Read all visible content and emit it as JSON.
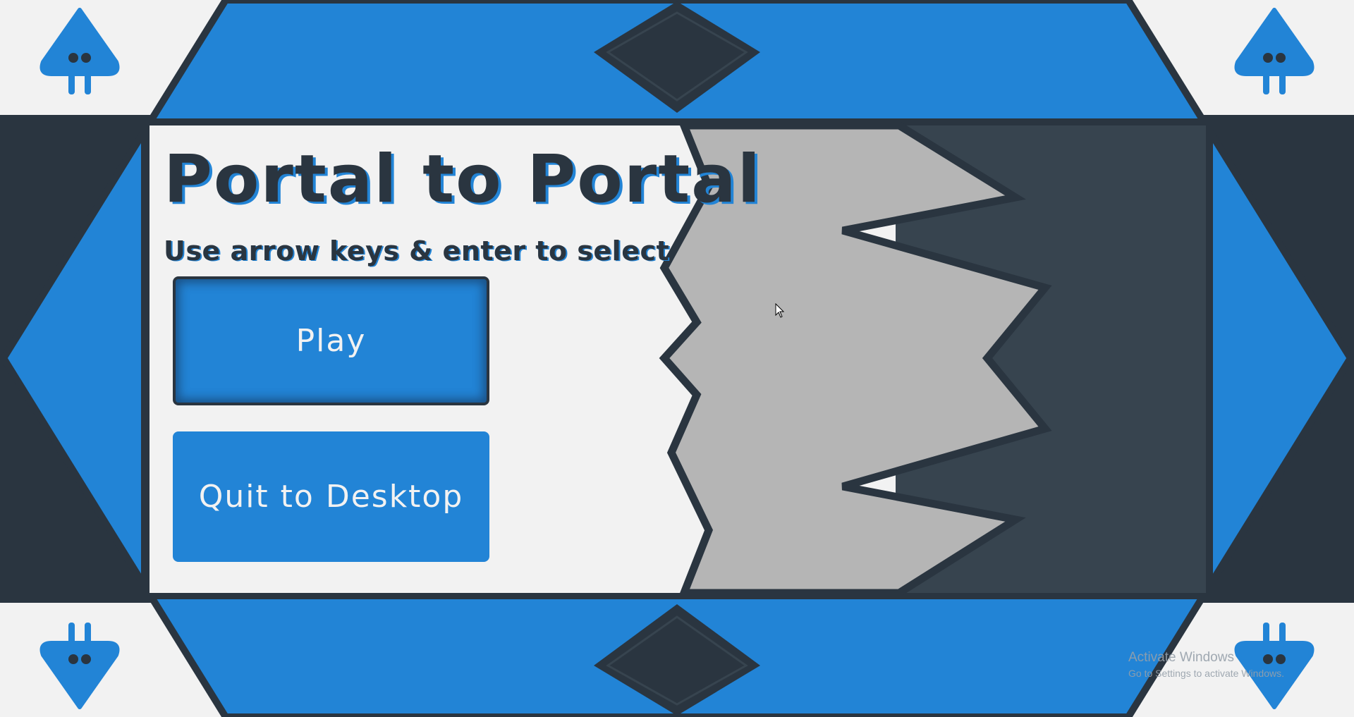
{
  "game": {
    "title": "Portal to Portal",
    "instructions": "Use arrow keys & enter to select"
  },
  "menu": {
    "play_label": "Play",
    "quit_label": "Quit to Desktop",
    "selected": "Play"
  },
  "os_watermark": {
    "line1": "Activate Windows",
    "line2": "Go to Settings to activate Windows."
  },
  "colors": {
    "blue": "#2284d6",
    "dark": "#2a3540",
    "panel_light": "#f2f2f2",
    "portal_gray": "#b5b5b5",
    "portal_dark": "#37444f"
  },
  "icons": [
    "plug-icon",
    "plug-icon",
    "plug-icon",
    "plug-icon",
    "diamond-icon",
    "diamond-icon"
  ]
}
